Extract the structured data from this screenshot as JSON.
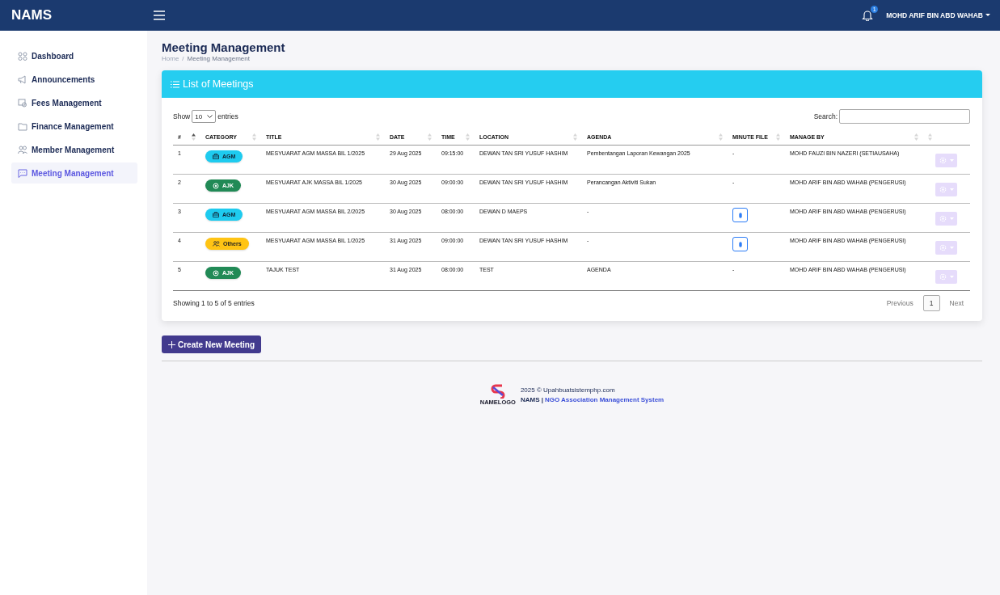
{
  "topbar": {
    "brand": "NAMS",
    "notification_count": "1",
    "user": "MOHD ARIF BIN ABD WAHAB"
  },
  "sidebar": {
    "items": [
      {
        "label": "Dashboard",
        "selected": false
      },
      {
        "label": "Announcements",
        "selected": false
      },
      {
        "label": "Fees Management",
        "selected": false
      },
      {
        "label": "Finance Management",
        "selected": false
      },
      {
        "label": "Member Management",
        "selected": false
      },
      {
        "label": "Meeting Management",
        "selected": true
      }
    ]
  },
  "page": {
    "title": "Meeting Management",
    "breadcrumb": [
      {
        "label": "Home",
        "kind": "link"
      },
      {
        "label": "/",
        "kind": "sep"
      },
      {
        "label": "Meeting Management",
        "kind": "current"
      }
    ]
  },
  "card": {
    "title": "List of Meetings",
    "length": {
      "before": "Show",
      "value": "10",
      "after": "entries"
    },
    "search": {
      "label": "Search:"
    },
    "columns": [
      {
        "label": "#",
        "sorted": true
      },
      {
        "label": "CATEGORY",
        "sorted": false
      },
      {
        "label": "TITLE",
        "sorted": false
      },
      {
        "label": "DATE",
        "sorted": false
      },
      {
        "label": "TIME",
        "sorted": false
      },
      {
        "label": "LOCATION",
        "sorted": false
      },
      {
        "label": "AGENDA",
        "sorted": false
      },
      {
        "label": "MINUTE FILE",
        "sorted": false
      },
      {
        "label": "MANAGE BY",
        "sorted": false
      },
      {
        "sorted": false
      }
    ],
    "rows": [
      {
        "no": "1",
        "category": {
          "kind": "agm",
          "label": "AGM"
        },
        "title": "MESYUARAT AGM MASSA BIL 1/2025",
        "date": "29 Aug 2025",
        "time": "09:15:00",
        "location": "DEWAN TAN SRI YUSUF HASHIM",
        "agenda": "Pembentangan Laporan Kewangan 2025",
        "minute_file": {
          "kind": "dash",
          "text": "-"
        },
        "manage_by": "MOHD FAUZI BIN NAZERI (SETIAUSAHA)"
      },
      {
        "no": "2",
        "category": {
          "kind": "ajk",
          "label": "AJK"
        },
        "title": "MESYUARAT AJK MASSA BIL 1/2025",
        "date": "30 Aug 2025",
        "time": "09:00:00",
        "location": "DEWAN TAN SRI YUSUF HASHIM",
        "agenda": "Perancangan Aktiviti Sukan",
        "minute_file": {
          "kind": "dash",
          "text": "-"
        },
        "manage_by": "MOHD ARIF BIN ABD WAHAB (PENGERUSI)"
      },
      {
        "no": "3",
        "category": {
          "kind": "agm",
          "label": "AGM"
        },
        "title": "MESYUARAT AGM MASSA BIL 2/2025",
        "date": "30 Aug 2025",
        "time": "08:00:00",
        "location": "DEWAN D MAEPS",
        "agenda": "-",
        "minute_file": {
          "kind": "file"
        },
        "manage_by": "MOHD ARIF BIN ABD WAHAB (PENGERUSI)"
      },
      {
        "no": "4",
        "category": {
          "kind": "others",
          "label": "Others"
        },
        "title": "MESYUARAT AGM MASSA BIL 1/2025",
        "date": "31 Aug 2025",
        "time": "09:00:00",
        "location": "DEWAN TAN SRI YUSUF HASHIM",
        "agenda": "-",
        "minute_file": {
          "kind": "file"
        },
        "manage_by": "MOHD ARIF BIN ABD WAHAB (PENGERUSI)"
      },
      {
        "no": "5",
        "category": {
          "kind": "ajk",
          "label": "AJK"
        },
        "title": "TAJUK TEST",
        "date": "31 Aug 2025",
        "time": "08:00:00",
        "location": "TEST",
        "agenda": "AGENDA",
        "minute_file": {
          "kind": "dash",
          "text": "-"
        },
        "manage_by": "MOHD ARIF BIN ABD WAHAB (PENGERUSI)"
      }
    ],
    "info": "Showing 1 to 5 of 5 entries",
    "pagination": [
      {
        "label": "Previous",
        "selected": false
      },
      {
        "label": "1",
        "selected": true
      },
      {
        "label": "Next",
        "selected": false
      }
    ]
  },
  "create_button": "Create New Meeting",
  "footer": {
    "logo_text": "NAMELOGO",
    "copyright": "2025 © Upahbuatsistemphp.com",
    "brand": "NAMS |",
    "link": "NGO Association Management System"
  }
}
